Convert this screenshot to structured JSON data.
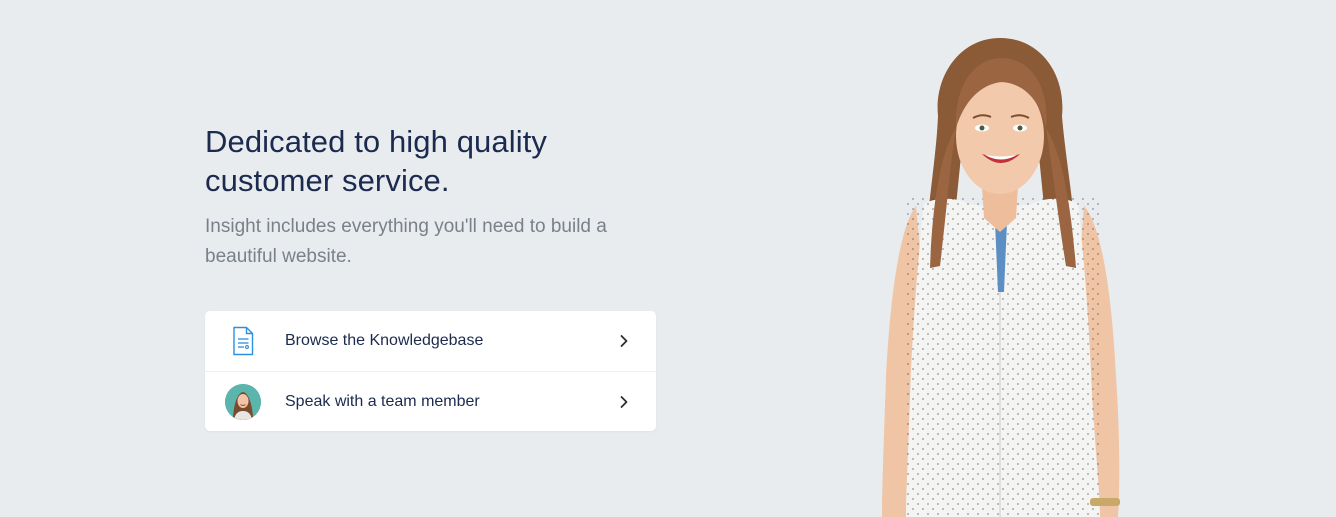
{
  "hero": {
    "headline_line1": "Dedicated to high quality",
    "headline_line2": "customer service.",
    "lead": "Insight includes everything you'll need to build a beautiful website."
  },
  "actions": [
    {
      "label": "Browse the Knowledgebase",
      "icon": "document-icon"
    },
    {
      "label": "Speak with a team member",
      "icon": "avatar"
    }
  ],
  "colors": {
    "background": "#e9ecef",
    "heading": "#1b2a4e",
    "body_text": "#7a808a",
    "accent": "#2d8fe0"
  }
}
